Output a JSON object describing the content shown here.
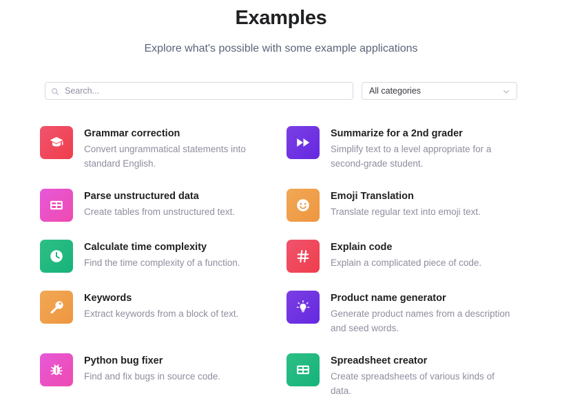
{
  "header": {
    "title": "Examples",
    "subtitle": "Explore what's possible with some example applications"
  },
  "search": {
    "placeholder": "Search...",
    "value": "",
    "icon": "search-icon"
  },
  "category_filter": {
    "selected": "All categories",
    "icon": "chevron-down-icon"
  },
  "colors": {
    "title": "#202123",
    "subtitle": "#5a6477",
    "description": "#8e8ea0",
    "border": "#d9d9e3",
    "background": "#ffffff"
  },
  "examples": [
    {
      "title": "Grammar correction",
      "description": "Convert ungrammatical statements into standard English.",
      "icon": "graduation-cap-icon",
      "tile_color_start": "#f0536d",
      "tile_color_end": "#ef3e4c"
    },
    {
      "title": "Summarize for a 2nd grader",
      "description": "Simplify text to a level appropriate for a second-grade student.",
      "icon": "fast-forward-icon",
      "tile_color_start": "#7b3fe4",
      "tile_color_end": "#6528e0"
    },
    {
      "title": "Parse unstructured data",
      "description": "Create tables from unstructured text.",
      "icon": "table-icon",
      "tile_color_start": "#e659d8",
      "tile_color_end": "#ef4ab0"
    },
    {
      "title": "Emoji Translation",
      "description": "Translate regular text into emoji text.",
      "icon": "smiley-face-icon",
      "tile_color_start": "#f0a854",
      "tile_color_end": "#ef9640"
    },
    {
      "title": "Calculate time complexity",
      "description": "Find the time complexity of a function.",
      "icon": "clock-icon",
      "tile_color_start": "#2dbf85",
      "tile_color_end": "#16b37a"
    },
    {
      "title": "Explain code",
      "description": "Explain a complicated piece of code.",
      "icon": "hash-icon",
      "tile_color_start": "#f0536d",
      "tile_color_end": "#ef3e4c"
    },
    {
      "title": "Keywords",
      "description": "Extract keywords from a block of text.",
      "icon": "key-icon",
      "tile_color_start": "#f0a854",
      "tile_color_end": "#ef9640"
    },
    {
      "title": "Product name generator",
      "description": "Generate product names from a description and seed words.",
      "icon": "lightbulb-icon",
      "tile_color_start": "#7b3fe4",
      "tile_color_end": "#6528e0"
    },
    {
      "title": "Python bug fixer",
      "description": "Find and fix bugs in source code.",
      "icon": "bug-icon",
      "tile_color_start": "#e659d8",
      "tile_color_end": "#ef4ab0"
    },
    {
      "title": "Spreadsheet creator",
      "description": "Create spreadsheets of various kinds of data.",
      "icon": "spreadsheet-icon",
      "tile_color_start": "#2dbf85",
      "tile_color_end": "#16b37a"
    }
  ]
}
